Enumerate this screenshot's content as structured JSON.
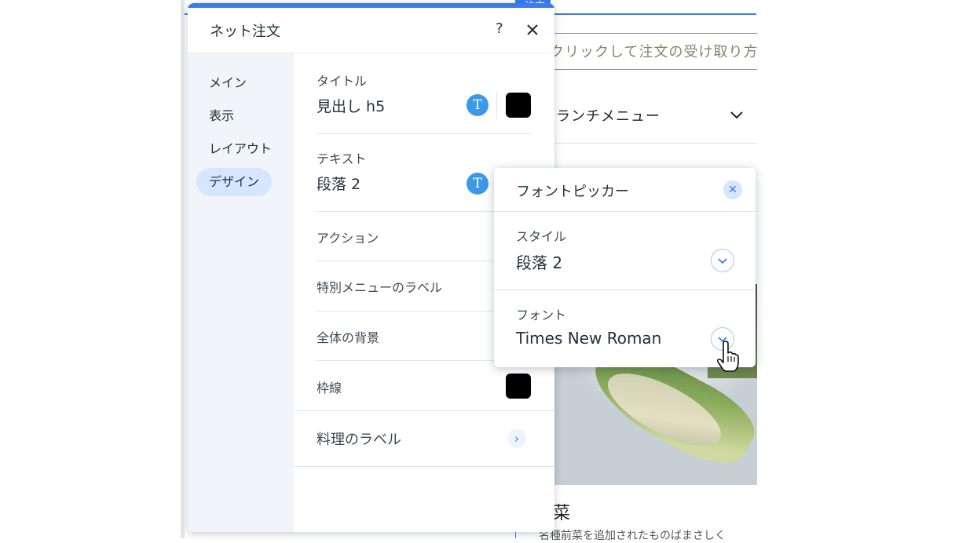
{
  "canvas": {
    "tag": "ネット注文",
    "tag_visible": "注文",
    "cta_text": "クリックして注文の受け取り方法",
    "menu_select": "ランチメニュー",
    "dish_title": "菜",
    "bottom_text": "名種前菜を追加されたものばまさしく"
  },
  "panel": {
    "title": "ネット注文",
    "help_label": "?",
    "sidebar": [
      {
        "label": "メイン"
      },
      {
        "label": "表示"
      },
      {
        "label": "レイアウト"
      },
      {
        "label": "デザイン",
        "active": true
      }
    ],
    "sections": {
      "title_label": "タイトル",
      "title_value": "見出し h5",
      "text_label": "テキスト",
      "text_value": "段落 2",
      "action_label": "アクション",
      "special_label": "特別メニューのラベル",
      "background_label": "全体の背景",
      "border_label": "枠線",
      "dish_label": "料理のラベル"
    },
    "t_icon": "T",
    "swatch_color": "#000000"
  },
  "font_picker": {
    "title": "フォントピッカー",
    "style_label": "スタイル",
    "style_value": "段落 2",
    "font_label": "フォント",
    "font_value": "Times New Roman"
  },
  "colors": {
    "accent": "#3b7bea",
    "sidebar_bg": "#f1f5f9",
    "active_item_bg": "#d6e6fe"
  }
}
